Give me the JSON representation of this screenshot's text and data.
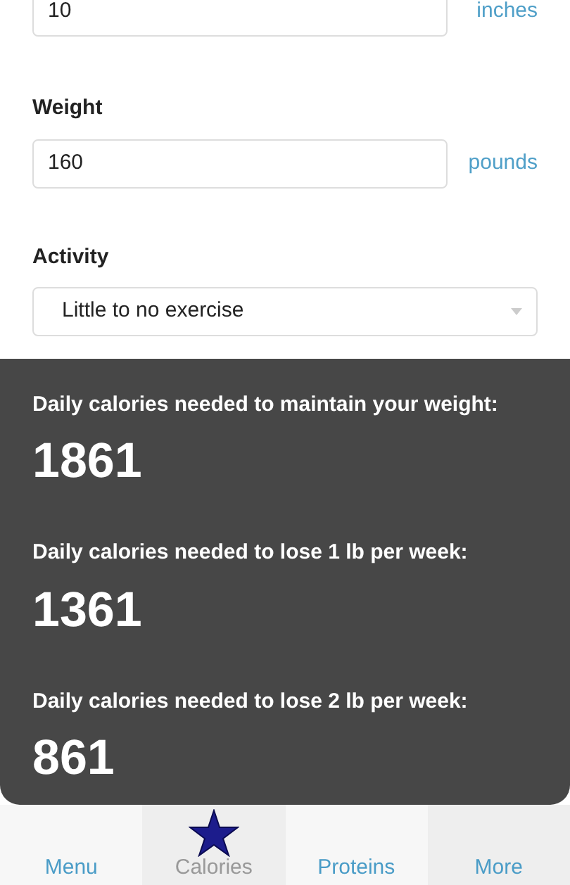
{
  "fields": [
    {
      "value": "10",
      "unit": "inches"
    },
    {
      "label": "Weight",
      "value": "160",
      "unit": "pounds"
    }
  ],
  "activity": {
    "label": "Activity",
    "value": "Little to no exercise"
  },
  "results": [
    {
      "heading": "Daily calories needed to maintain your weight:",
      "value": "1861"
    },
    {
      "heading": "Daily calories needed to lose 1 lb per week:",
      "value": "1361"
    },
    {
      "heading": "Daily calories needed to lose 2 lb per week:",
      "value": "861"
    }
  ],
  "nav": [
    {
      "label": "Menu",
      "selected": false
    },
    {
      "label": "Calories",
      "selected": true
    },
    {
      "label": "Proteins",
      "selected": false
    },
    {
      "label": "More",
      "selected": false
    }
  ]
}
